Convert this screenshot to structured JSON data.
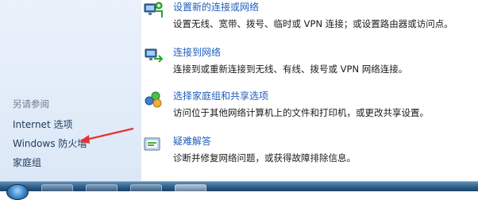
{
  "sidebar": {
    "see_also": "另请参阅",
    "links": [
      "Internet 选项",
      "Windows 防火墙",
      "家庭组"
    ]
  },
  "tasks": [
    {
      "icon": "new-connection-icon",
      "title": "设置新的连接或网络",
      "desc": "设置无线、宽带、拨号、临时或 VPN 连接；或设置路由器或访问点。"
    },
    {
      "icon": "connect-network-icon",
      "title": "连接到网络",
      "desc": "连接到或重新连接到无线、有线、拨号或 VPN 网络连接。"
    },
    {
      "icon": "homegroup-sharing-icon",
      "title": "选择家庭组和共享选项",
      "desc": "访问位于其他网络计算机上的文件和打印机，或更改共享设置。"
    },
    {
      "icon": "troubleshoot-icon",
      "title": "疑难解答",
      "desc": "诊断并修复网络问题，或获得故障排除信息。"
    }
  ],
  "colors": {
    "link": "#1e5dbd",
    "sidebar_link": "#1e395b",
    "arrow": "#e53333"
  }
}
